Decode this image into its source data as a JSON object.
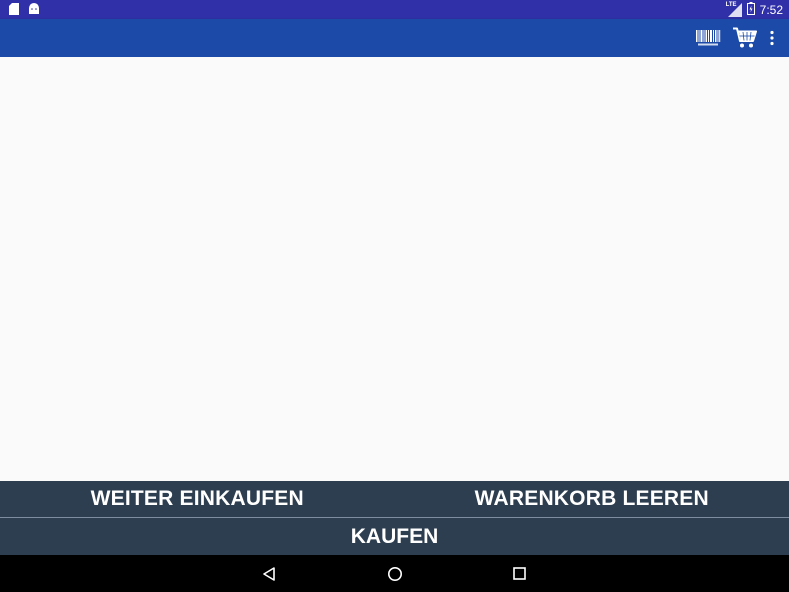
{
  "status_bar": {
    "time": "7:52",
    "network": "LTE",
    "icons": [
      "sd-card-icon",
      "android-icon",
      "signal-icon",
      "battery-icon"
    ]
  },
  "toolbar": {
    "actions": [
      "barcode-scan-icon",
      "shopping-cart-icon",
      "more-vert-icon"
    ]
  },
  "cart": {
    "continue_shopping_label": "WEITER EINKAUFEN",
    "empty_cart_label": "WARENKORB LEEREN",
    "buy_label": "KAUFEN"
  },
  "nav": {
    "buttons": [
      "back-icon",
      "home-icon",
      "recents-icon"
    ]
  },
  "colors": {
    "status_bar": "#3030a8",
    "app_bar": "#1b4aa8",
    "content_bg": "#fafafa",
    "button_bg": "#2d3e50",
    "button_text": "#ffffff",
    "nav_bar": "#000000"
  }
}
